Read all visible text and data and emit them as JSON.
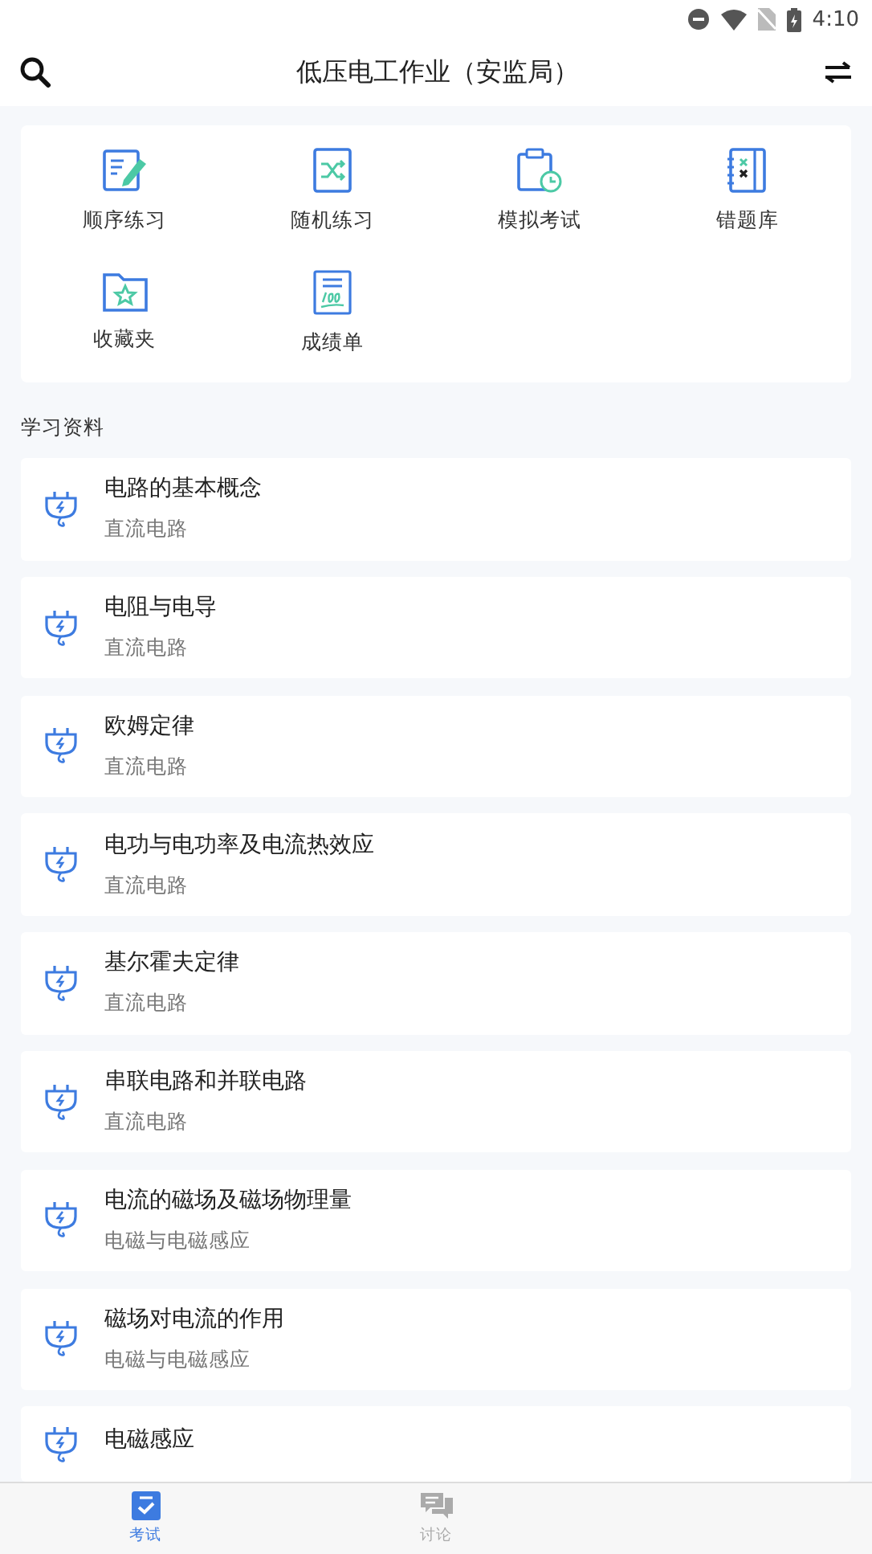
{
  "status_bar": {
    "time": "4:10"
  },
  "header": {
    "title": "低压电工作业（安监局）"
  },
  "shortcuts": [
    {
      "kind": "sequential",
      "label": "顺序练习"
    },
    {
      "kind": "random",
      "label": "随机练习"
    },
    {
      "kind": "exam",
      "label": "模拟考试"
    },
    {
      "kind": "mistakes",
      "label": "错题库"
    },
    {
      "kind": "favorites",
      "label": "收藏夹"
    },
    {
      "kind": "scores",
      "label": "成绩单"
    }
  ],
  "section_title": "学习资料",
  "materials": [
    {
      "title": "电路的基本概念",
      "subtitle": "直流电路"
    },
    {
      "title": "电阻与电导",
      "subtitle": "直流电路"
    },
    {
      "title": "欧姆定律",
      "subtitle": "直流电路"
    },
    {
      "title": "电功与电功率及电流热效应",
      "subtitle": "直流电路"
    },
    {
      "title": "基尔霍夫定律",
      "subtitle": "直流电路"
    },
    {
      "title": "串联电路和并联电路",
      "subtitle": "直流电路"
    },
    {
      "title": "电流的磁场及磁场物理量",
      "subtitle": "电磁与电磁感应"
    },
    {
      "title": "磁场对电流的作用",
      "subtitle": "电磁与电磁感应"
    },
    {
      "title": "电磁感应"
    }
  ],
  "bottom_nav": [
    {
      "kind": "exam",
      "label": "考试",
      "selected": true
    },
    {
      "kind": "discuss",
      "label": "讨论",
      "selected": false
    }
  ]
}
